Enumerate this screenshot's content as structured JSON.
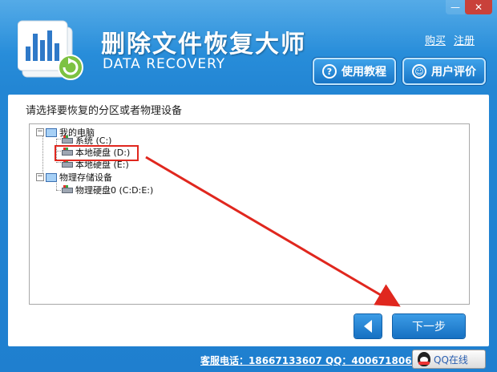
{
  "window": {
    "app_title": "删除文件恢复大师",
    "app_subtitle": "DATA RECOVERY",
    "minimize_label": "—",
    "close_label": "✕"
  },
  "header": {
    "link_buy": "购买",
    "link_register": "注册",
    "btn_tutorial": "使用教程",
    "btn_review": "用户评价",
    "tutorial_icon": "?",
    "review_icon": "☺"
  },
  "panel": {
    "instruction": "请选择要恢复的分区或者物理设备",
    "tree": {
      "root": "我的电脑",
      "drives": [
        {
          "label": "系统 (C:)"
        },
        {
          "label": "本地硬盘 (D:)"
        },
        {
          "label": "本地硬盘 (E:)"
        }
      ],
      "physical_root": "物理存储设备",
      "physical_items": [
        {
          "label": "物理硬盘0 (C:D:E:)"
        }
      ],
      "expander": "−"
    },
    "next_label": "下一步"
  },
  "footer": {
    "hotline": "客服电话：18667133607 QQ：4006718068",
    "qq_label": "QQ在线"
  },
  "colors": {
    "accent": "#2386d4",
    "highlight": "#e0271e",
    "arrow": "#e0271e"
  }
}
